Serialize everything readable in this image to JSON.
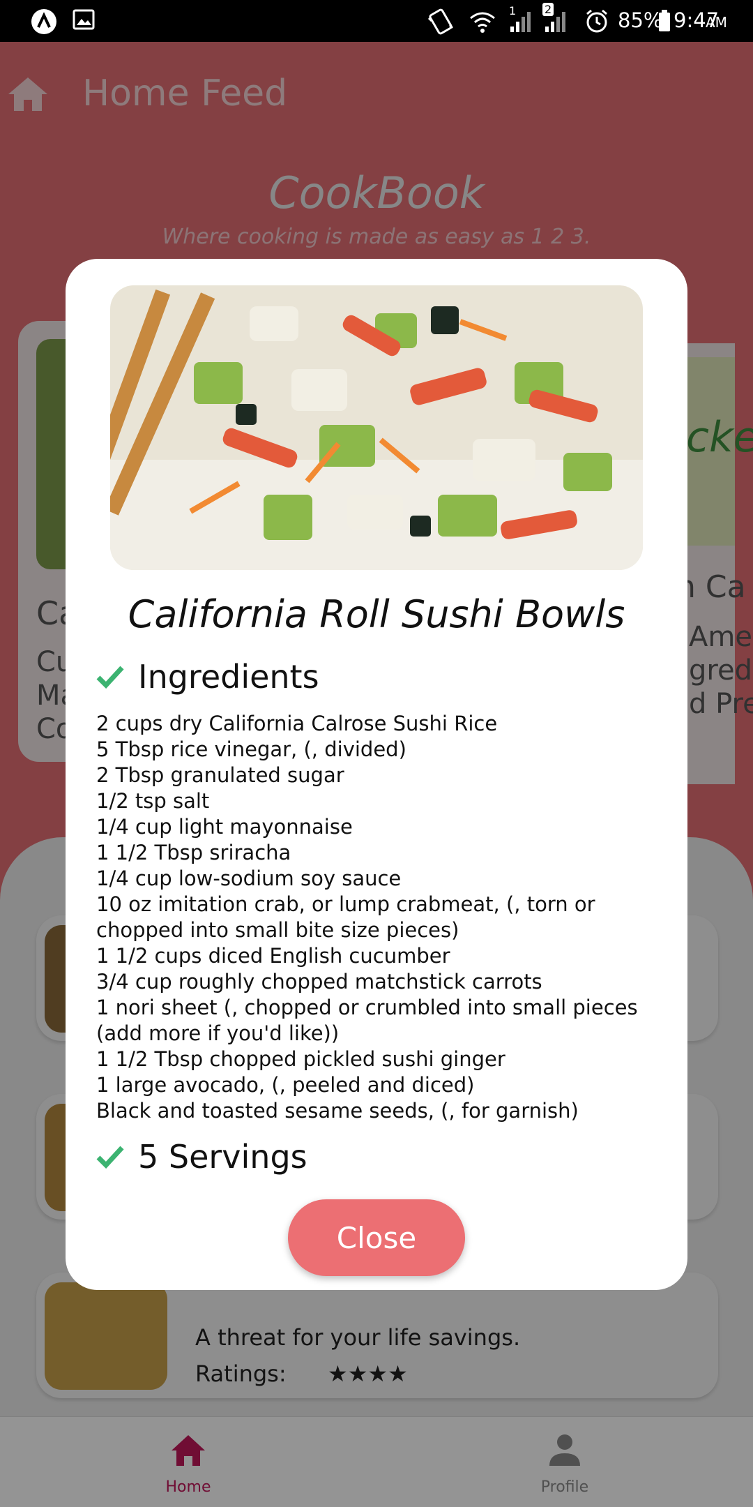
{
  "status_bar": {
    "battery": "85%",
    "time": "9:47",
    "ampm": "AM",
    "sim2_badge": "2",
    "sim1_label": "1"
  },
  "app_bar": {
    "title": "Home Feed"
  },
  "brand": {
    "title": "CookBook",
    "subtitle": "Where cooking is made as easy as 1 2 3."
  },
  "background_cards": {
    "left_lines": [
      "Ca",
      "Cu",
      "Ma",
      "Co"
    ],
    "right_lines": [
      "n Ca",
      "Ame",
      "gredi",
      "d Pre"
    ],
    "right_banner_text": "cke"
  },
  "feed_list": {
    "last_item_description": "A threat for your life savings.",
    "last_item_ratings_label": "Ratings:",
    "last_item_stars": "★★★★"
  },
  "bottom_nav": {
    "home_label": "Home",
    "profile_label": "Profile"
  },
  "modal": {
    "title": "California Roll Sushi Bowls",
    "ingredients_heading": "Ingredients",
    "ingredients": [
      "2 cups dry California Calrose Sushi Rice",
      "5 Tbsp rice vinegar, (, divided)",
      "2 Tbsp granulated sugar",
      "1/2 tsp salt",
      "1/4 cup light mayonnaise",
      "1 1/2 Tbsp sriracha",
      "1/4 cup low-sodium soy sauce",
      "10 oz imitation crab, or lump crabmeat, (, torn or chopped into small bite size pieces)",
      "1 1/2 cups diced English cucumber",
      "3/4 cup roughly chopped matchstick carrots",
      "1 nori sheet (, chopped or crumbled into small pieces (add more if you'd like))",
      "1 1/2 Tbsp chopped pickled sushi ginger",
      "1 large avocado, (, peeled and diced)",
      "Black and toasted sesame seeds, (, for garnish)"
    ],
    "servings": "5 Servings",
    "close_label": "Close"
  },
  "colors": {
    "primary": "#ec6f73",
    "check_green": "#3cb371",
    "nav_active": "#c2185b",
    "nav_inactive": "#8a8a8a"
  }
}
